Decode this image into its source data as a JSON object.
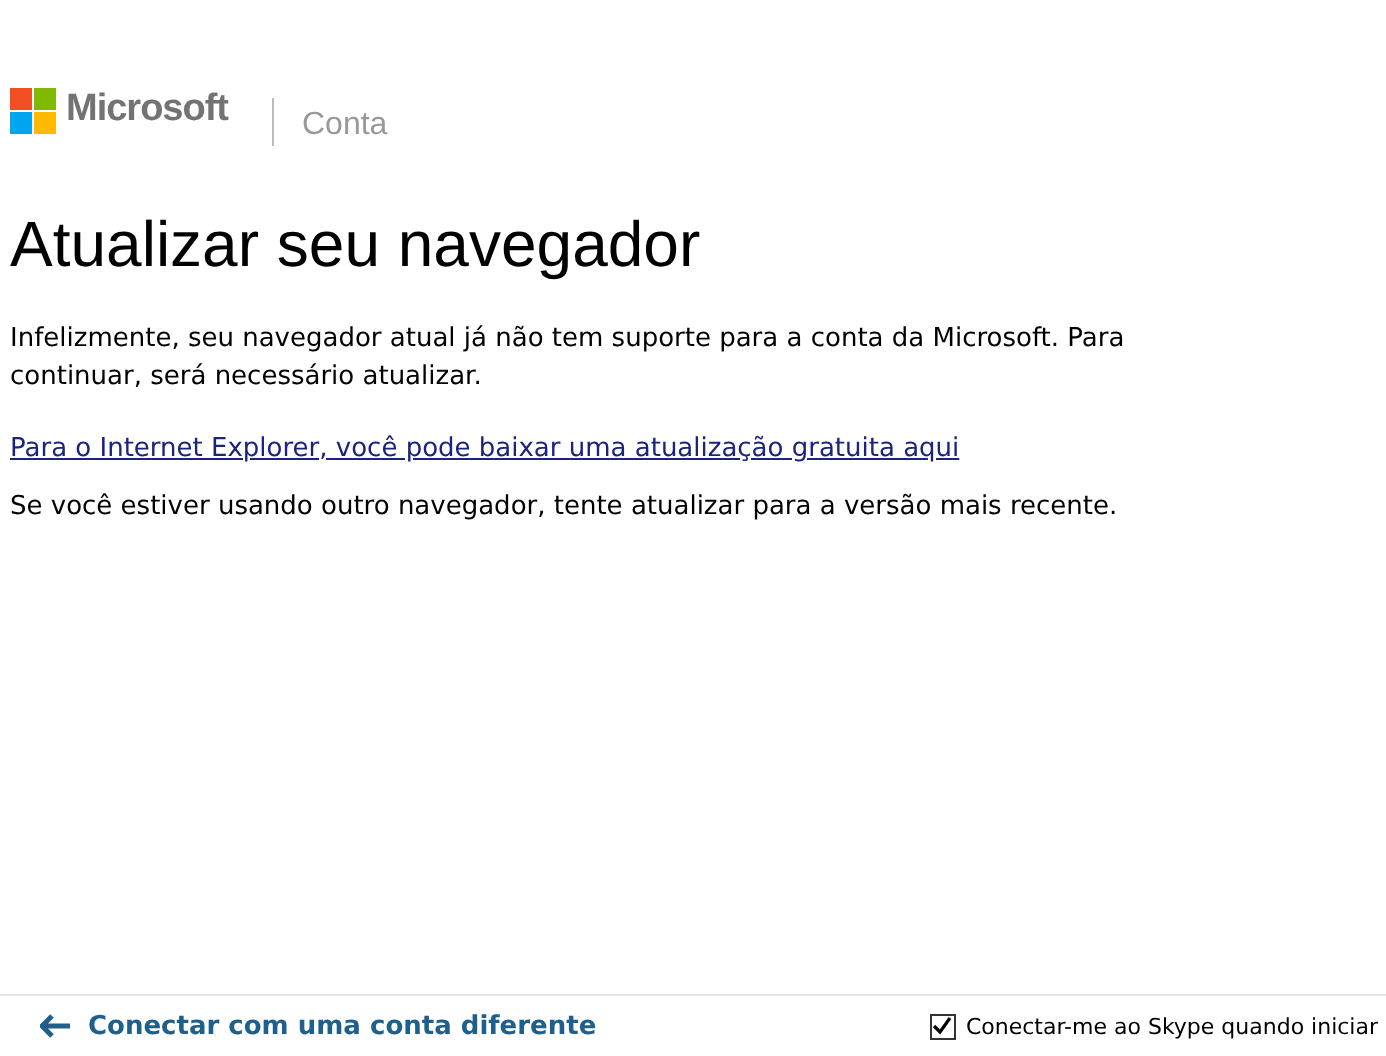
{
  "header": {
    "brand": "Microsoft",
    "section": "Conta"
  },
  "title": "Atualizar seu navegador",
  "message": "Infelizmente, seu navegador atual já não tem suporte para a conta da Microsoft. Para continuar, será necessário atualizar.",
  "link": "Para o Internet Explorer, você pode baixar uma atualização gratuita aqui",
  "note": "Se você estiver usando outro navegador, tente atualizar para a versão mais recente.",
  "footer": {
    "back_link": "Conectar com uma conta diferente",
    "skype_option": {
      "label": "Conectar-me ao Skype quando iniciar",
      "checked": true
    }
  }
}
